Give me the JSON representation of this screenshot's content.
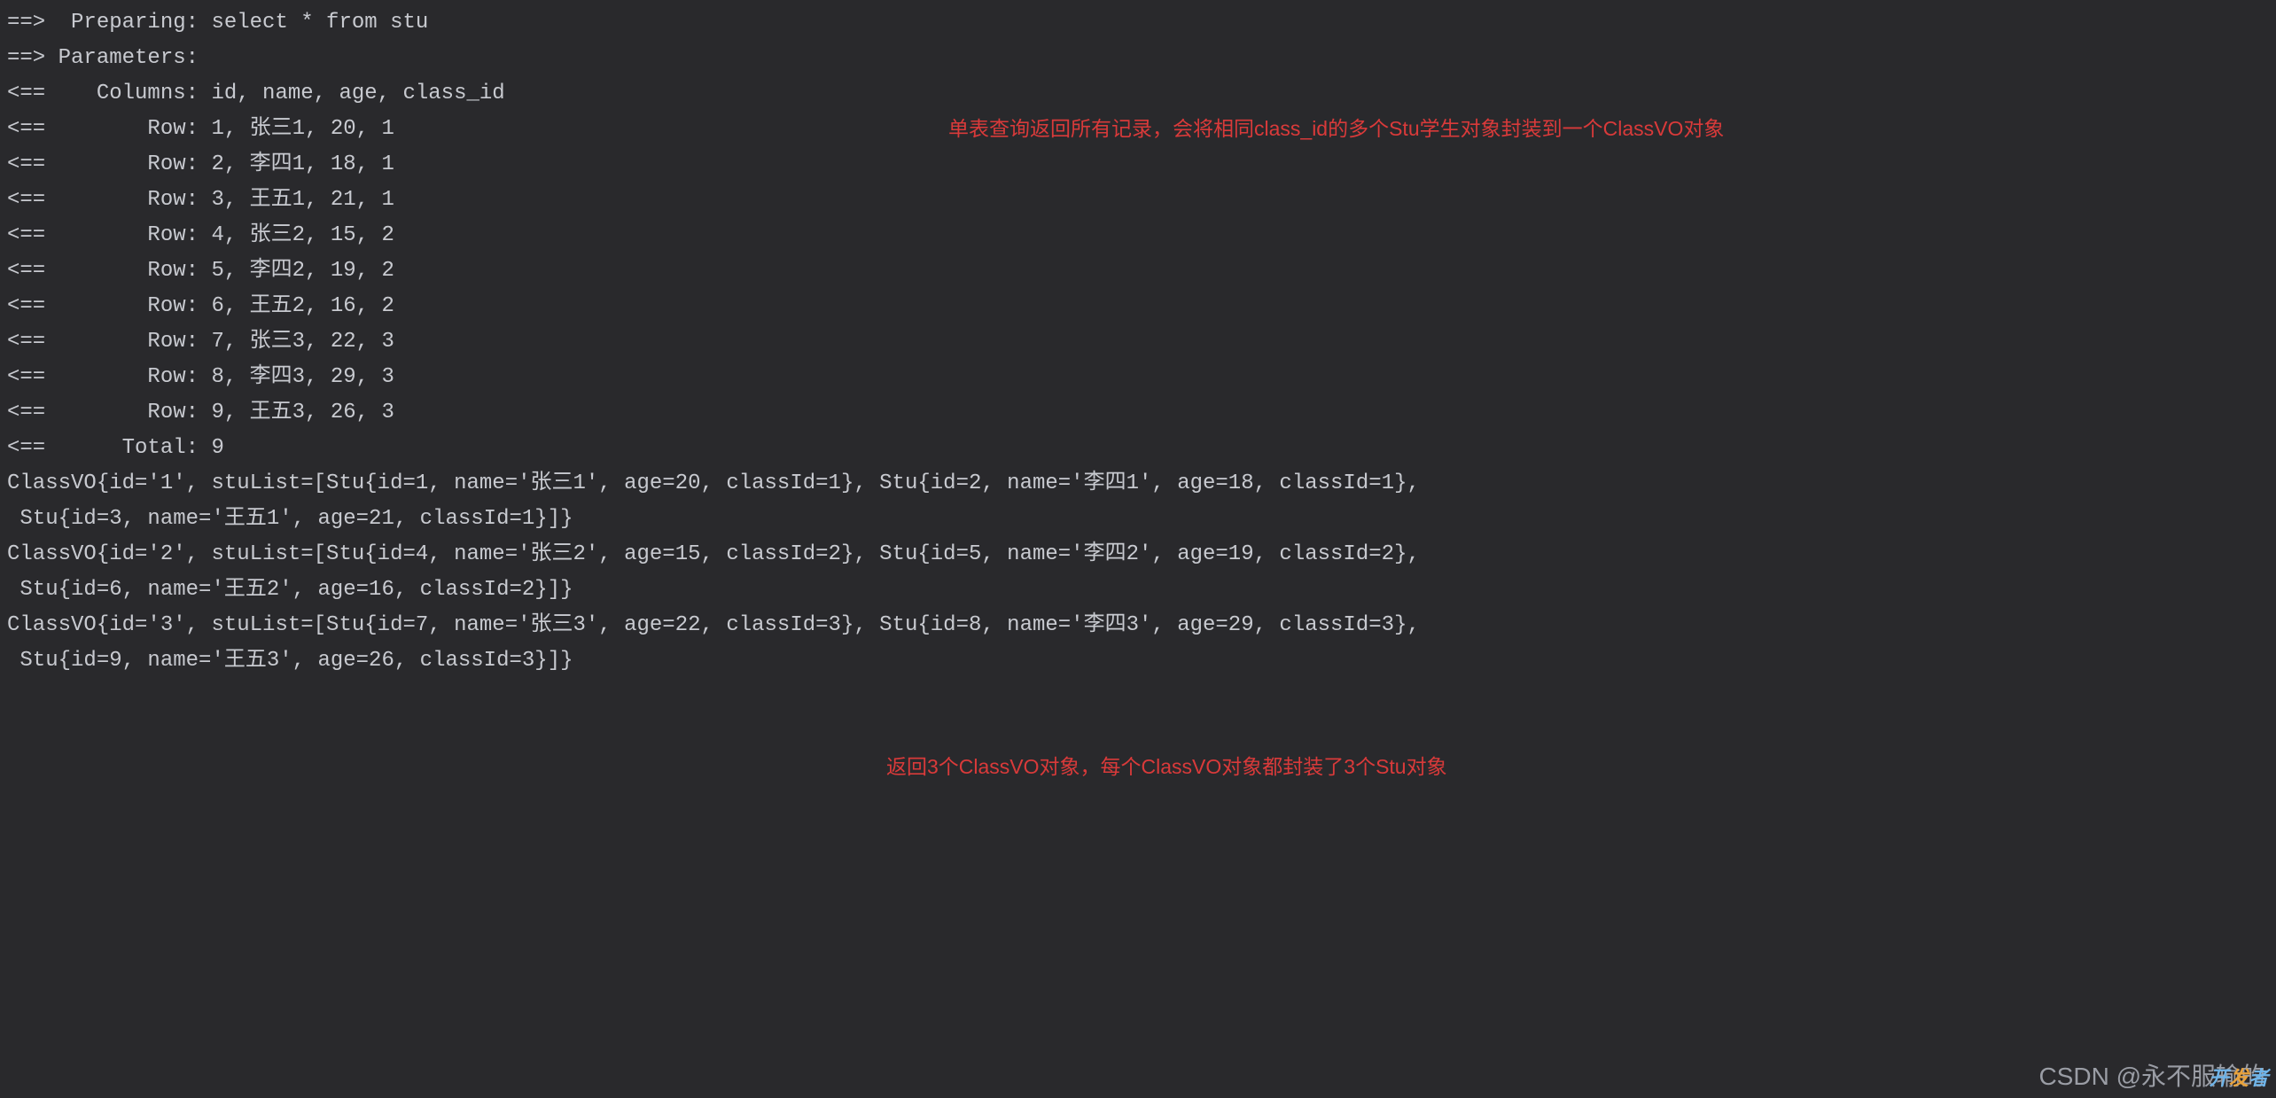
{
  "log": {
    "preparing": "==>  Preparing: select * from stu",
    "parameters": "==> Parameters:",
    "columns": "<==    Columns: id, name, age, class_id",
    "rows": [
      "<==        Row: 1, 张三1, 20, 1",
      "<==        Row: 2, 李四1, 18, 1",
      "<==        Row: 3, 王五1, 21, 1",
      "<==        Row: 4, 张三2, 15, 2",
      "<==        Row: 5, 李四2, 19, 2",
      "<==        Row: 6, 王五2, 16, 2",
      "<==        Row: 7, 张三3, 22, 3",
      "<==        Row: 8, 李四3, 29, 3",
      "<==        Row: 9, 王五3, 26, 3"
    ],
    "total": "<==      Total: 9",
    "output": [
      "ClassVO{id='1', stuList=[Stu{id=1, name='张三1', age=20, classId=1}, Stu{id=2, name='李四1', age=18, classId=1},",
      " Stu{id=3, name='王五1', age=21, classId=1}]}",
      "ClassVO{id='2', stuList=[Stu{id=4, name='张三2', age=15, classId=2}, Stu{id=5, name='李四2', age=19, classId=2},",
      " Stu{id=6, name='王五2', age=16, classId=2}]}",
      "ClassVO{id='3', stuList=[Stu{id=7, name='张三3', age=22, classId=3}, Stu{id=8, name='李四3', age=29, classId=3},",
      " Stu{id=9, name='王五3', age=26, classId=3}]}"
    ]
  },
  "annotations": {
    "a1": "单表查询返回所有记录，会将相同class_id的多个Stu学生对象封装到一个ClassVO对象",
    "a2": "返回3个ClassVO对象，每个ClassVO对象都封装了3个Stu对象"
  },
  "watermark": {
    "csdn": "CSDN @永不服输的",
    "logo": "开发者"
  },
  "sql": {
    "statement": "select * from stu",
    "columns": [
      "id",
      "name",
      "age",
      "class_id"
    ],
    "rows": [
      {
        "id": 1,
        "name": "张三1",
        "age": 20,
        "class_id": 1
      },
      {
        "id": 2,
        "name": "李四1",
        "age": 18,
        "class_id": 1
      },
      {
        "id": 3,
        "name": "王五1",
        "age": 21,
        "class_id": 1
      },
      {
        "id": 4,
        "name": "张三2",
        "age": 15,
        "class_id": 2
      },
      {
        "id": 5,
        "name": "李四2",
        "age": 19,
        "class_id": 2
      },
      {
        "id": 6,
        "name": "王五2",
        "age": 16,
        "class_id": 2
      },
      {
        "id": 7,
        "name": "张三3",
        "age": 22,
        "class_id": 3
      },
      {
        "id": 8,
        "name": "李四3",
        "age": 29,
        "class_id": 3
      },
      {
        "id": 9,
        "name": "王五3",
        "age": 26,
        "class_id": 3
      }
    ],
    "total": 9
  },
  "result_objects": [
    {
      "id": "1",
      "stuList": [
        {
          "id": 1,
          "name": "张三1",
          "age": 20,
          "classId": 1
        },
        {
          "id": 2,
          "name": "李四1",
          "age": 18,
          "classId": 1
        },
        {
          "id": 3,
          "name": "王五1",
          "age": 21,
          "classId": 1
        }
      ]
    },
    {
      "id": "2",
      "stuList": [
        {
          "id": 4,
          "name": "张三2",
          "age": 15,
          "classId": 2
        },
        {
          "id": 5,
          "name": "李四2",
          "age": 19,
          "classId": 2
        },
        {
          "id": 6,
          "name": "王五2",
          "age": 16,
          "classId": 2
        }
      ]
    },
    {
      "id": "3",
      "stuList": [
        {
          "id": 7,
          "name": "张三3",
          "age": 22,
          "classId": 3
        },
        {
          "id": 8,
          "name": "李四3",
          "age": 29,
          "classId": 3
        },
        {
          "id": 9,
          "name": "王五3",
          "age": 26,
          "classId": 3
        }
      ]
    }
  ]
}
